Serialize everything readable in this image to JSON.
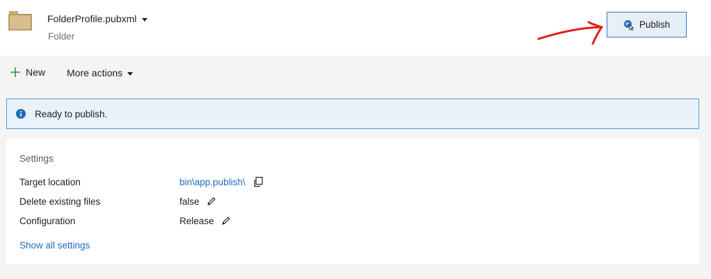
{
  "header": {
    "profile_name": "FolderProfile.pubxml",
    "profile_type": "Folder",
    "folder_icon": "folder-icon",
    "publish_button": {
      "label": "Publish",
      "icon": "globe-cursor-icon"
    }
  },
  "toolbar": {
    "new_label": "New",
    "new_icon": "plus-icon",
    "more_actions_label": "More actions"
  },
  "info_bar": {
    "icon": "info-icon",
    "message": "Ready to publish."
  },
  "settings": {
    "title": "Settings",
    "rows": [
      {
        "label": "Target location",
        "value": "bin\\app.publish\\",
        "action_icon": "copy-icon"
      },
      {
        "label": "Delete existing files",
        "value": "false",
        "action_icon": "pencil-icon"
      },
      {
        "label": "Configuration",
        "value": "Release",
        "action_icon": "pencil-icon"
      }
    ],
    "show_all_label": "Show all settings"
  },
  "colors": {
    "accent": "#1f6bb8",
    "info_border": "#4f9ad4",
    "info_background": "#e7f2fb",
    "annotation_arrow": "#e0211c"
  }
}
